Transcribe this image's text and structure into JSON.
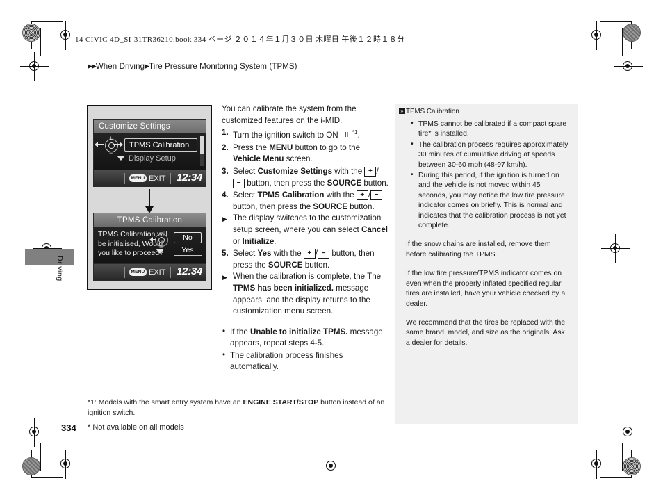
{
  "print_header": "14 CIVIC 4D_SI-31TR36210.book   334 ページ   ２０１４年１月３０日   木曜日   午後１２時１８分",
  "breadcrumb": {
    "level1": "When Driving",
    "level2": "Tire Pressure Monitoring System (TPMS)"
  },
  "side_tab": {
    "label": "Driving"
  },
  "screens": {
    "screen1": {
      "title": "Customize Settings",
      "selected_item": "TPMS Calibration",
      "next_item": "Display Setup",
      "menu_badge": "MENU",
      "exit_label": "EXIT",
      "clock": "12:34",
      "wheel_plus": "+",
      "wheel_minus": "−"
    },
    "screen2": {
      "title": "TPMS Calibration",
      "message": "TPMS Calibration will be initialised, Would you like to proceed?",
      "button_no": "No",
      "button_yes": "Yes",
      "menu_badge": "MENU",
      "exit_label": "EXIT",
      "clock": "12:34",
      "wheel_plus": "+",
      "wheel_minus": "−"
    }
  },
  "main": {
    "intro": "You can calibrate the system from the customized features on the i-MID.",
    "steps": [
      {
        "num": "1.",
        "parts": [
          {
            "t": "Turn the ignition switch to ON "
          },
          {
            "t": "II",
            "style": "keybox"
          },
          {
            "t": "*1",
            "style": "sup"
          },
          {
            "t": "."
          }
        ]
      },
      {
        "num": "2.",
        "parts": [
          {
            "t": "Press the "
          },
          {
            "t": "MENU",
            "style": "bold"
          },
          {
            "t": " button to go to the "
          },
          {
            "t": "Vehicle Menu",
            "style": "bold"
          },
          {
            "t": " screen."
          }
        ]
      },
      {
        "num": "3.",
        "parts": [
          {
            "t": "Select "
          },
          {
            "t": "Customize Settings",
            "style": "bold"
          },
          {
            "t": " with the "
          },
          {
            "t": "+",
            "style": "keybox"
          },
          {
            "t": "/"
          },
          {
            "t": "−",
            "style": "keybox"
          },
          {
            "t": " button, then press the "
          },
          {
            "t": "SOURCE",
            "style": "bold"
          },
          {
            "t": " button."
          }
        ]
      },
      {
        "num": "4.",
        "parts": [
          {
            "t": "Select "
          },
          {
            "t": "TPMS Calibration",
            "style": "bold"
          },
          {
            "t": " with the "
          },
          {
            "t": "+",
            "style": "keybox"
          },
          {
            "t": "/"
          },
          {
            "t": "−",
            "style": "keybox"
          },
          {
            "t": " button, then press the "
          },
          {
            "t": "SOURCE",
            "style": "bold"
          },
          {
            "t": " button."
          }
        ]
      }
    ],
    "sub4": [
      {
        "t": "The display switches to the customization setup screen, where you can select "
      },
      {
        "t": "Cancel",
        "style": "bold"
      },
      {
        "t": " or "
      },
      {
        "t": "Initialize",
        "style": "bold"
      },
      {
        "t": "."
      }
    ],
    "step5": {
      "num": "5.",
      "parts": [
        {
          "t": "Select "
        },
        {
          "t": "Yes",
          "style": "bold"
        },
        {
          "t": " with the "
        },
        {
          "t": "+",
          "style": "keybox"
        },
        {
          "t": "/"
        },
        {
          "t": "−",
          "style": "keybox"
        },
        {
          "t": " button, then press the "
        },
        {
          "t": "SOURCE",
          "style": "bold"
        },
        {
          "t": " button."
        }
      ]
    },
    "sub5": [
      {
        "t": "When the calibration is complete, the The "
      },
      {
        "t": "TPMS has been initialized.",
        "style": "bold"
      },
      {
        "t": " message appears, and the display returns to the customization menu screen."
      }
    ],
    "notes": [
      [
        {
          "t": "If the "
        },
        {
          "t": "Unable to initialize TPMS.",
          "style": "bold"
        },
        {
          "t": " message appears, repeat steps 4-5."
        }
      ],
      [
        {
          "t": "The calibration process finishes automatically."
        }
      ]
    ]
  },
  "sidebar": {
    "title": "TPMS Calibration",
    "marker_glyph": "»",
    "bullets": [
      "TPMS cannot be calibrated if a compact spare tire* is installed.",
      "The calibration process requires approximately 30 minutes of cumulative driving at speeds between 30-60 mph (48-97 km/h).",
      "During this period, if the ignition is turned on and the vehicle is not moved within 45 seconds, you may notice the low tire pressure indicator comes on briefly. This is normal and indicates that the calibration process is not yet complete."
    ],
    "paragraphs": [
      "If the snow chains are installed, remove them before calibrating the TPMS.",
      "If the low tire pressure/TPMS indicator comes on even when the properly inflated specified regular tires are installed, have your vehicle checked by a dealer.",
      "We recommend that the tires be replaced with the same brand, model, and size as the originals. Ask a dealer for details."
    ]
  },
  "footer": {
    "footnote_parts": [
      {
        "t": "*1: Models with the smart entry system have an "
      },
      {
        "t": "ENGINE START/STOP",
        "style": "bold"
      },
      {
        "t": " button instead of an ignition switch."
      }
    ],
    "asterisk_note": "* Not available on all models",
    "page_number": "334"
  }
}
